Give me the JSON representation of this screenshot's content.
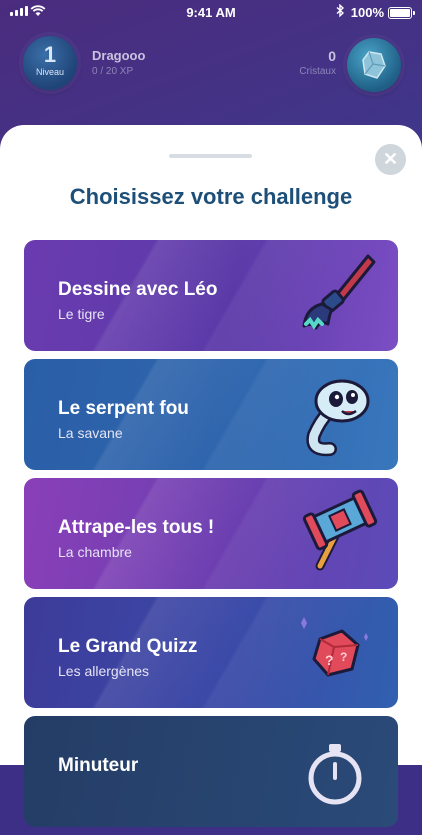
{
  "status_bar": {
    "time": "9:41 AM",
    "battery": "100%"
  },
  "header": {
    "level_number": "1",
    "level_label": "Niveau",
    "player_name": "Dragooo",
    "xp": "0 / 20 XP",
    "crystals_count": "0",
    "crystals_label": "Cristaux"
  },
  "sheet": {
    "title": "Choisissez votre challenge",
    "close_symbol": "✕",
    "challenges": [
      {
        "title": "Dessine avec Léo",
        "subtitle": "Le tigre",
        "icon": "paintbrush-icon",
        "color": "#6a3bb0"
      },
      {
        "title": "Le serpent fou",
        "subtitle": "La savane",
        "icon": "snake-icon",
        "color": "#2a5fa8"
      },
      {
        "title": "Attrape-les tous !",
        "subtitle": "La chambre",
        "icon": "hammer-icon",
        "color": "#8a3fb8"
      },
      {
        "title": "Le Grand Quizz",
        "subtitle": "Les allergènes",
        "icon": "gem-question-icon",
        "color": "#3d3b9a"
      },
      {
        "title": "Minuteur",
        "subtitle": "",
        "icon": "stopwatch-icon",
        "color": "#243d66"
      }
    ]
  }
}
